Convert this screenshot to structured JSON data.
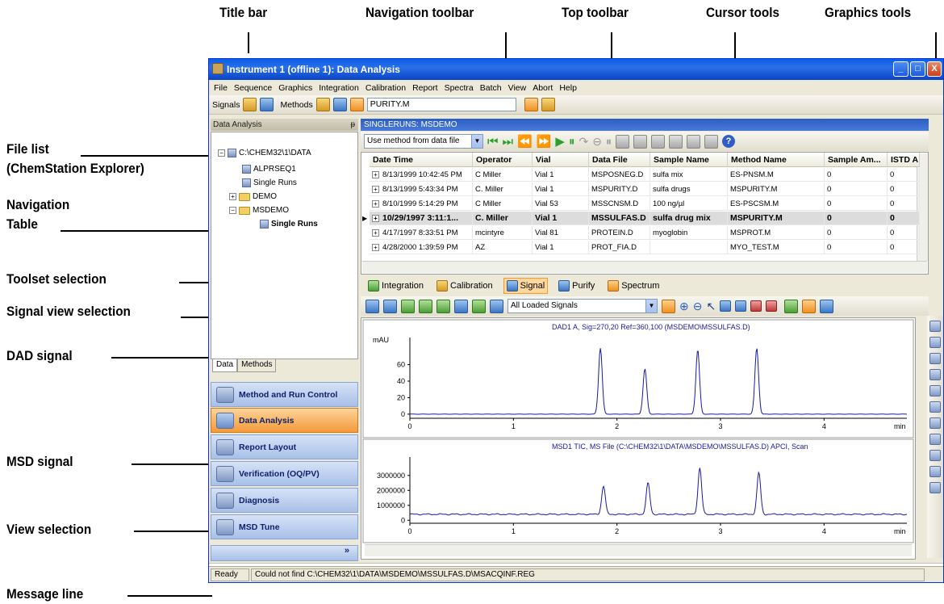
{
  "callouts": {
    "title_bar": "Title bar",
    "navigation_toolbar": "Navigation toolbar",
    "top_toolbar": "Top toolbar",
    "cursor_tools": "Cursor tools",
    "graphics_tools": "Graphics tools",
    "file_list_1": "File list",
    "file_list_2": "(ChemStation Explorer)",
    "navigation_table_1": "Navigation",
    "navigation_table_2": "Table",
    "toolset_selection": "Toolset selection",
    "signal_view_selection": "Signal view selection",
    "dad_signal": "DAD signal",
    "msd_signal": "MSD signal",
    "view_selection": "View selection",
    "message_line": "Message line"
  },
  "window": {
    "title": "Instrument 1 (offline 1): Data Analysis",
    "minimize": "_",
    "maximize": "□",
    "close": "X"
  },
  "menu": [
    "File",
    "Sequence",
    "Graphics",
    "Integration",
    "Calibration",
    "Report",
    "Spectra",
    "Batch",
    "View",
    "Abort",
    "Help"
  ],
  "top_toolbar": {
    "signals_label": "Signals",
    "methods_label": "Methods",
    "method_value": "PURITY.M"
  },
  "left_panel": {
    "header": "Data Analysis",
    "pin": "ᵽ",
    "tree": [
      {
        "label": "C:\\CHEM32\\1\\DATA",
        "level": 0
      },
      {
        "label": "ALPRSEQ1",
        "level": 1
      },
      {
        "label": "Single Runs",
        "level": 1
      },
      {
        "label": "DEMO",
        "level": 1
      },
      {
        "label": "MSDEMO",
        "level": 1
      },
      {
        "label": "Single Runs",
        "level": 2
      }
    ],
    "tabs": [
      "Data",
      "Methods"
    ],
    "views": [
      {
        "label": "Method and Run Control",
        "active": false
      },
      {
        "label": "Data Analysis",
        "active": true
      },
      {
        "label": "Report Layout",
        "active": false
      },
      {
        "label": "Verification (OQ/PV)",
        "active": false
      },
      {
        "label": "Diagnosis",
        "active": false
      },
      {
        "label": "MSD Tune",
        "active": false
      }
    ],
    "more": "»"
  },
  "right_panel": {
    "header": "SINGLERUNS: MSDEMO",
    "method_select": "Use method from data file"
  },
  "table": {
    "columns": [
      "Date Time",
      "Operator",
      "Vial",
      "Data File",
      "Sample Name",
      "Method Name",
      "Sample Am...",
      "ISTD A"
    ],
    "rows": [
      [
        "8/13/1999 10:42:45 PM",
        "C Miller",
        "Vial 1",
        "MSPOSNEG.D",
        "sulfa mix",
        "ES-PNSM.M",
        "0",
        "0"
      ],
      [
        "8/13/1999 5:43:34 PM",
        "C. Miller",
        "Vial 1",
        "MSPURITY.D",
        "sulfa drugs",
        "MSPURITY.M",
        "0",
        "0"
      ],
      [
        "8/10/1999 5:14:29 PM",
        "C Miller",
        "Vial 53",
        "MSSCNSM.D",
        "100 ng/µl",
        "ES-PSCSM.M",
        "0",
        "0"
      ],
      [
        "10/29/1997 3:11:1...",
        "C. Miller",
        "Vial 1",
        "MSSULFAS.D",
        "sulfa drug mix",
        "MSPURITY.M",
        "0",
        "0"
      ],
      [
        "4/17/1997 8:33:51 PM",
        "mcintyre",
        "Vial 81",
        "PROTEIN.D",
        "myoglobin",
        "MSPROT.M",
        "0",
        "0"
      ],
      [
        "4/28/2000 1:39:59 PM",
        "AZ",
        "Vial 1",
        "PROT_FIA.D",
        "",
        "MYO_TEST.M",
        "0",
        "0"
      ]
    ],
    "selected_row": 3
  },
  "toolsets": [
    {
      "label": "Integration",
      "active": false
    },
    {
      "label": "Calibration",
      "active": false
    },
    {
      "label": "Signal",
      "active": true
    },
    {
      "label": "Purify",
      "active": false
    },
    {
      "label": "Spectrum",
      "active": false
    }
  ],
  "signal_view_select": "All Loaded Signals",
  "plots": {
    "dad": {
      "label": "DAD1 A, Sig=270,20 Ref=360,100 (MSDEMO\\MSSULFAS.D)",
      "yunit": "mAU",
      "yticks": [
        "60",
        "40",
        "20",
        "0"
      ],
      "xticks": [
        "0",
        "1",
        "2",
        "3",
        "4"
      ],
      "xunit": "min"
    },
    "msd": {
      "label": "MSD1 TIC, MS File (C:\\CHEM32\\1\\DATA\\MSDEMO\\MSSULFAS.D)  APCI, Scan",
      "yticks": [
        "3000000",
        "2000000",
        "1000000",
        "0"
      ],
      "xticks": [
        "0",
        "1",
        "2",
        "3",
        "4"
      ],
      "xunit": "min"
    }
  },
  "chart_data": [
    {
      "type": "line",
      "title": "DAD1 A, Sig=270,20 Ref=360,100 (MSDEMO\\MSSULFAS.D)",
      "ylabel": "mAU",
      "xlabel": "min",
      "xlim": [
        0,
        4.8
      ],
      "ylim": [
        -5,
        85
      ],
      "peaks": [
        {
          "x": 1.84,
          "y": 80
        },
        {
          "x": 2.27,
          "y": 55
        },
        {
          "x": 2.78,
          "y": 78
        },
        {
          "x": 3.35,
          "y": 80
        }
      ],
      "color": "#1a1aa0"
    },
    {
      "type": "line",
      "title": "MSD1 TIC, MS File (C:\\CHEM32\\1\\DATA\\MSDEMO\\MSSULFAS.D)  APCI, Scan",
      "ylabel": "",
      "xlabel": "min",
      "xlim": [
        0,
        4.8
      ],
      "ylim": [
        -200000,
        3800000
      ],
      "baseline": 400000,
      "peaks": [
        {
          "x": 1.87,
          "y": 2300000
        },
        {
          "x": 2.3,
          "y": 2500000
        },
        {
          "x": 2.8,
          "y": 3500000
        },
        {
          "x": 3.37,
          "y": 3200000
        }
      ],
      "color": "#1a1aa0"
    }
  ],
  "status": {
    "ready": "Ready",
    "message": "Could not find C:\\CHEM32\\1\\DATA\\MSDEMO\\MSSULFAS.D\\MSACQINF.REG"
  }
}
